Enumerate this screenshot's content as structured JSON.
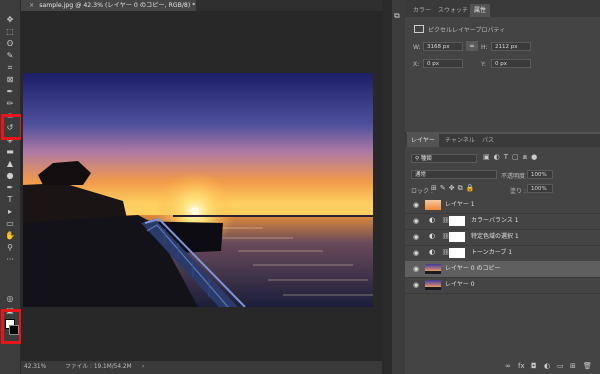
{
  "document": {
    "tab_title": "sample.jpg @ 42.3% (レイヤー 0 のコピー, RGB/8) *",
    "close_glyph": "×"
  },
  "status": {
    "zoom": "42.31%",
    "file_info": "ファイル : 19.1M/54.2M",
    "arrow": "›"
  },
  "toolbar": {
    "tools": [
      "move-icon",
      "marquee-icon",
      "lasso-icon",
      "quick-select-icon",
      "crop-icon",
      "frame-icon",
      "eyedropper-icon",
      "brush-icon",
      "stamp-icon",
      "history-brush-icon",
      "eraser-icon",
      "gradient-icon",
      "blur-icon",
      "dodge-icon",
      "pen-icon",
      "type-icon",
      "path-select-icon",
      "shape-icon",
      "hand-icon",
      "zoom-icon",
      "more-icon",
      "color-swatch-icon",
      "quick-mask-icon",
      "screen-mode-icon"
    ],
    "glyphs": [
      "✥",
      "⬚",
      "ʘ",
      "✎",
      "⌗",
      "⊠",
      "✒",
      "✏",
      "⛀",
      "↺",
      "◈",
      "▬",
      "▲",
      "●",
      "✒",
      "T",
      "▸",
      "▭",
      "✋",
      "⚲",
      "···",
      "",
      "◎",
      "▣"
    ],
    "highlight_color": "#e8161b"
  },
  "properties": {
    "tabs": [
      "カラー",
      "スウォッチ",
      "属性"
    ],
    "active_tab": "属性",
    "section": "ピクセルレイヤープロパティ",
    "w_label": "W:",
    "w_value": "3168 px",
    "h_label": "H:",
    "h_value": "2112 px",
    "link_icon": "∞",
    "x_label": "X:",
    "x_value": "0 px",
    "y_label": "Y:",
    "y_value": "0 px"
  },
  "layers": {
    "tabs": [
      "レイヤー",
      "チャンネル",
      "パス"
    ],
    "active_tab": "レイヤー",
    "filter_label": "種類",
    "blend_mode": "通常",
    "opacity_label": "不透明度 :",
    "opacity_value": "100%",
    "lock_label": "ロック :",
    "fill_label": "塗り :",
    "fill_value": "100%",
    "items": [
      {
        "name": "レイヤー 1",
        "kind": "gradient"
      },
      {
        "name": "カラーバランス 1",
        "kind": "adjust"
      },
      {
        "name": "特定色域の選択 1",
        "kind": "adjust"
      },
      {
        "name": "トーンカーブ 1",
        "kind": "adjust"
      },
      {
        "name": "レイヤー 0 のコピー",
        "kind": "photo",
        "selected": true
      },
      {
        "name": "レイヤー 0",
        "kind": "photo"
      }
    ],
    "footer_icons": [
      "link-layers-icon",
      "fx-icon",
      "mask-icon",
      "adjustment-icon",
      "group-icon",
      "new-layer-icon",
      "trash-icon"
    ],
    "footer_glyphs": [
      "∞",
      "fx",
      "◘",
      "◐",
      "▭",
      "⊞",
      "🗑"
    ]
  }
}
